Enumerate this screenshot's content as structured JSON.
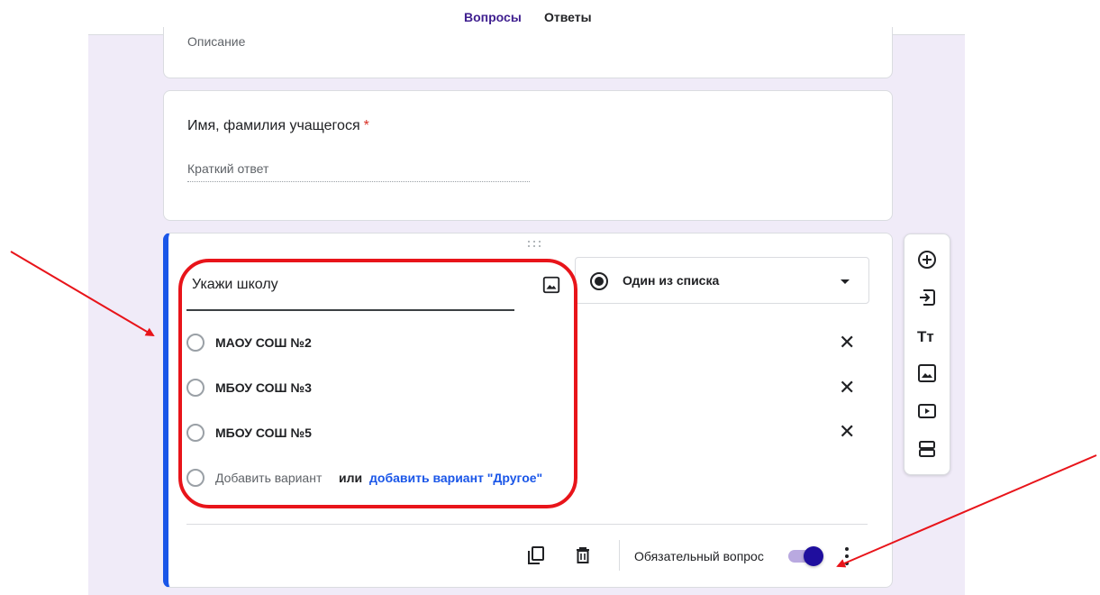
{
  "tabs": [
    {
      "label": "Вопросы",
      "active": true
    },
    {
      "label": "Ответы",
      "active": false
    }
  ],
  "description_card": {
    "placeholder": "Описание"
  },
  "name_question": {
    "title": "Имя, фамилия учащегося",
    "required_mark": "*",
    "answer_placeholder": "Краткий ответ"
  },
  "active_question": {
    "title": "Укажи школу",
    "type_label": "Один из списка",
    "options": [
      {
        "label": "МАОУ СОШ №2"
      },
      {
        "label": "МБОУ СОШ №3"
      },
      {
        "label": "МБОУ СОШ №5"
      }
    ],
    "add_option": {
      "label": "Добавить вариант",
      "or": "или",
      "add_other": "добавить вариант \"Другое\""
    },
    "remove_icon": "close-icon",
    "required_label": "Обязательный вопрос",
    "required_on": true
  },
  "side_toolbar": {
    "text_tool": "Тт",
    "icons": [
      "add-circle-icon",
      "import-icon",
      "title-icon",
      "image-icon",
      "video-icon",
      "section-icon"
    ]
  },
  "colors": {
    "accent": "#5a32b4",
    "active_border": "#1a56e8",
    "annotation": "#e8141a",
    "background": "#f0ebf8"
  }
}
